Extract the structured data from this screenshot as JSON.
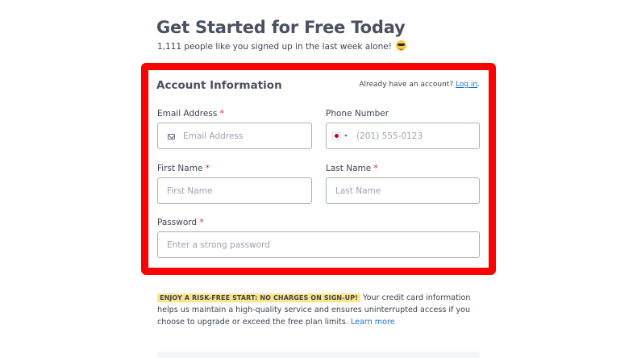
{
  "header": {
    "title": "Get Started for Free Today",
    "subtitle": "1,111 people like you signed up in the last week alone!",
    "subtitle_emoji": "sunglasses-emoji"
  },
  "account": {
    "title": "Account Information",
    "login_prompt": "Already have an account?",
    "login_link": "Log in",
    "login_period": "."
  },
  "fields": {
    "required_mark": "*",
    "email": {
      "label": "Email Address",
      "placeholder": "Email Address",
      "value": ""
    },
    "phone": {
      "label": "Phone Number",
      "placeholder": "(201) 555-0123",
      "value": "",
      "country": "Japan"
    },
    "first_name": {
      "label": "First Name",
      "placeholder": "First Name",
      "value": ""
    },
    "last_name": {
      "label": "Last Name",
      "placeholder": "Last Name",
      "value": ""
    },
    "password": {
      "label": "Password",
      "placeholder": "Enter a strong password",
      "value": ""
    }
  },
  "notice": {
    "badge": "ENJOY A RISK-FREE START: NO CHARGES ON SIGN-UP!",
    "text": "Your credit card information helps us maintain a high-quality service and ensures uninterrupted access if you choose to upgrade or exceed the free plan limits.",
    "link": "Learn more"
  },
  "colors": {
    "highlight": "#ff0000",
    "link": "#1a6fd6",
    "required": "#e0262a",
    "badge_bg": "#fde68a"
  }
}
